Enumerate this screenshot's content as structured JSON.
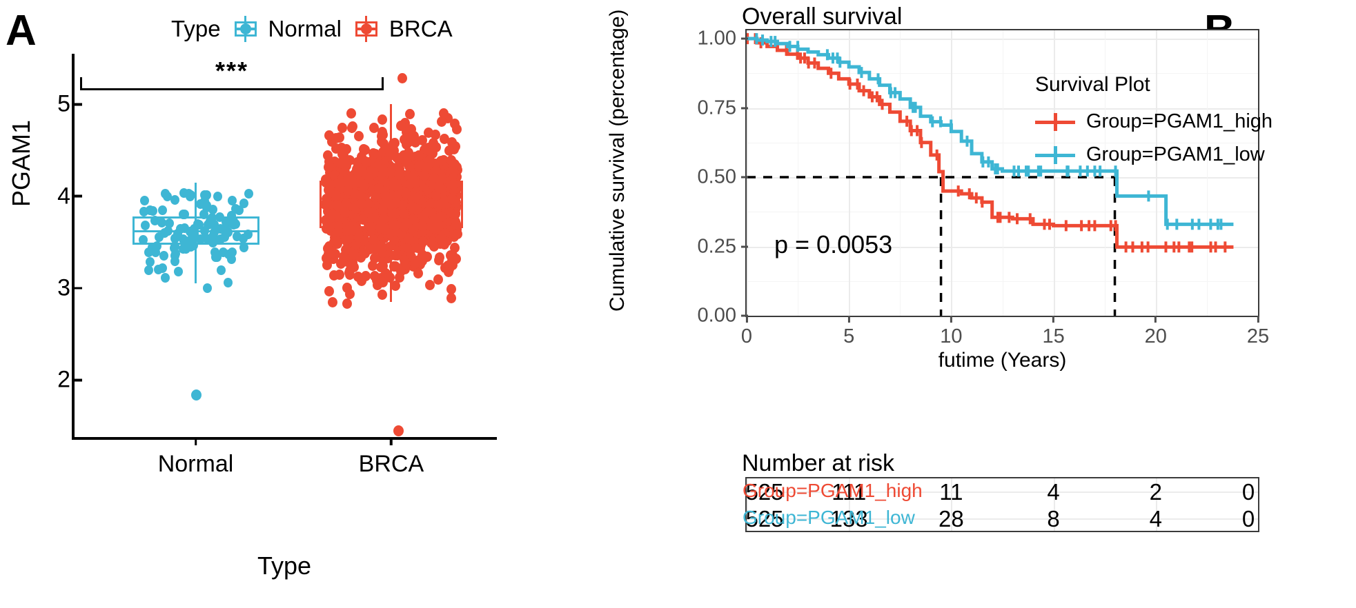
{
  "figure": {
    "panel_a_letter": "A",
    "panel_b_letter": "B"
  },
  "colors": {
    "normal_blue": "#3EB6D4",
    "brca_red": "#EE4A34",
    "axis_black": "#000000",
    "grid_grey": "#EBEBEB",
    "tick_grey": "#4D4D4D"
  },
  "panel_a": {
    "legend": {
      "title": "Type",
      "entries": [
        {
          "label": "Normal",
          "color": "#3EB6D4",
          "key": "boxplot-key-icon"
        },
        {
          "label": "BRCA",
          "color": "#EE4A34",
          "key": "boxplot-key-icon"
        }
      ]
    },
    "significance": {
      "stars": "***",
      "comparison": "Normal vs BRCA"
    },
    "chart_data": {
      "type": "box",
      "title": "",
      "xlabel": "Type",
      "ylabel": "PGAM1",
      "categories": [
        "Normal",
        "BRCA"
      ],
      "ytick_labels": [
        "2",
        "3",
        "4",
        "5"
      ],
      "ytick_values": [
        2,
        3,
        4,
        5
      ],
      "ylim": [
        1.35,
        5.55
      ],
      "grid": false,
      "legend_position": "top",
      "annotations": [
        {
          "text": "***",
          "between": [
            "Normal",
            "BRCA"
          ],
          "y": 5.35
        }
      ],
      "series": [
        {
          "name": "Normal",
          "color": "#3EB6D4",
          "box": {
            "q1": 3.47,
            "median": 3.62,
            "q3": 3.78,
            "whisker_low": 3.05,
            "whisker_high": 4.15
          },
          "n_points": 112,
          "outlier_low": 1.84
        },
        {
          "name": "BRCA",
          "color": "#EE4A34",
          "box": {
            "q1": 3.65,
            "median": 3.9,
            "q3": 4.17,
            "whisker_low": 2.85,
            "whisker_high": 5.0
          },
          "n_points": 1050,
          "outlier_low": 1.45
        }
      ]
    }
  },
  "panel_b": {
    "km": {
      "title": "Overall survival",
      "xlabel": "futime (Years)",
      "ylabel": "Cumulative survival (percentage)",
      "pvalue_text": "p = 0.0053",
      "legend_title": "Survival Plot",
      "legend_entries": [
        {
          "label": "Group=PGAM1_high",
          "color": "#EE4A34"
        },
        {
          "label": "Group=PGAM1_low",
          "color": "#3EB6D4"
        }
      ],
      "median_lines": {
        "horizontal_at": 0.5,
        "vertical_high": 9.5,
        "vertical_low": 18.0
      }
    },
    "chart_data": {
      "type": "line",
      "subtype": "kaplan-meier",
      "title": "Overall survival",
      "xlabel": "futime (Years)",
      "ylabel": "Cumulative survival (percentage)",
      "xlim": [
        0,
        25
      ],
      "ylim": [
        0,
        1.03
      ],
      "xtick_labels": [
        "0",
        "5",
        "10",
        "15",
        "20",
        "25"
      ],
      "xtick_values": [
        0,
        5,
        10,
        15,
        20,
        25
      ],
      "ytick_labels": [
        "0.00",
        "0.25",
        "0.50",
        "0.75",
        "1.00"
      ],
      "ytick_values": [
        0.0,
        0.25,
        0.5,
        0.75,
        1.0
      ],
      "grid": true,
      "legend_position": "inside-top-right",
      "annotations": [
        {
          "text": "p = 0.0053",
          "x": 1.0,
          "y": 0.22
        }
      ],
      "series": [
        {
          "name": "Group=PGAM1_high",
          "color": "#EE4A34",
          "points": [
            [
              0,
              1.0
            ],
            [
              0.5,
              0.985
            ],
            [
              1.0,
              0.972
            ],
            [
              1.5,
              0.958
            ],
            [
              2.0,
              0.944
            ],
            [
              2.5,
              0.93
            ],
            [
              3.0,
              0.912
            ],
            [
              3.5,
              0.893
            ],
            [
              4.0,
              0.875
            ],
            [
              4.5,
              0.855
            ],
            [
              5.0,
              0.836
            ],
            [
              5.5,
              0.812
            ],
            [
              6.0,
              0.79
            ],
            [
              6.5,
              0.763
            ],
            [
              7.0,
              0.735
            ],
            [
              7.5,
              0.702
            ],
            [
              8.0,
              0.668
            ],
            [
              8.5,
              0.625
            ],
            [
              9.0,
              0.58
            ],
            [
              9.4,
              0.52
            ],
            [
              9.6,
              0.45
            ],
            [
              10.5,
              0.44
            ],
            [
              11.0,
              0.425
            ],
            [
              11.5,
              0.41
            ],
            [
              12.0,
              0.355
            ],
            [
              13.0,
              0.35
            ],
            [
              14.0,
              0.33
            ],
            [
              15.0,
              0.325
            ],
            [
              17.0,
              0.325
            ],
            [
              17.9,
              0.325
            ],
            [
              18.1,
              0.248
            ],
            [
              20.0,
              0.248
            ],
            [
              22.0,
              0.248
            ],
            [
              23.8,
              0.248
            ]
          ]
        },
        {
          "name": "Group=PGAM1_low",
          "color": "#3EB6D4",
          "points": [
            [
              0,
              1.0
            ],
            [
              0.5,
              0.995
            ],
            [
              1.0,
              0.99
            ],
            [
              1.5,
              0.982
            ],
            [
              2.0,
              0.972
            ],
            [
              2.5,
              0.962
            ],
            [
              3.0,
              0.952
            ],
            [
              3.5,
              0.942
            ],
            [
              4.0,
              0.93
            ],
            [
              4.5,
              0.915
            ],
            [
              5.0,
              0.898
            ],
            [
              5.5,
              0.878
            ],
            [
              6.0,
              0.855
            ],
            [
              6.5,
              0.832
            ],
            [
              7.0,
              0.805
            ],
            [
              7.5,
              0.782
            ],
            [
              8.0,
              0.752
            ],
            [
              8.5,
              0.72
            ],
            [
              9.0,
              0.7
            ],
            [
              9.5,
              0.688
            ],
            [
              10.0,
              0.665
            ],
            [
              10.5,
              0.63
            ],
            [
              11.0,
              0.585
            ],
            [
              11.5,
              0.555
            ],
            [
              12.0,
              0.53
            ],
            [
              12.5,
              0.522
            ],
            [
              14.0,
              0.522
            ],
            [
              16.0,
              0.522
            ],
            [
              17.9,
              0.522
            ],
            [
              18.1,
              0.432
            ],
            [
              20.2,
              0.432
            ],
            [
              20.5,
              0.33
            ],
            [
              22.0,
              0.33
            ],
            [
              23.8,
              0.33
            ]
          ]
        }
      ]
    },
    "risk_table": {
      "title": "Number at risk",
      "column_values": [
        0,
        5,
        10,
        15,
        20,
        25
      ],
      "rows": [
        {
          "label": "Group=PGAM1_high",
          "color": "#EE4A34",
          "values": [
            "525",
            "111",
            "11",
            "4",
            "2",
            "0"
          ]
        },
        {
          "label": "Group=PGAM1_low",
          "color": "#3EB6D4",
          "values": [
            "525",
            "133",
            "28",
            "8",
            "4",
            "0"
          ]
        }
      ]
    }
  }
}
